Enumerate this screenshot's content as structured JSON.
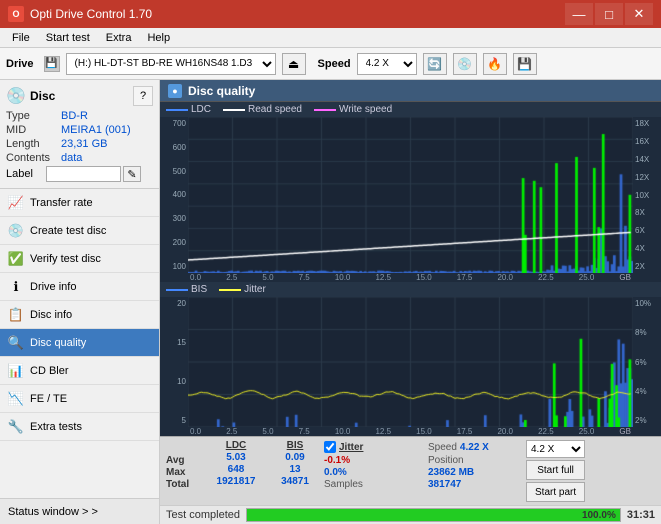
{
  "titleBar": {
    "title": "Opti Drive Control 1.70",
    "minBtn": "—",
    "maxBtn": "□",
    "closeBtn": "✕"
  },
  "menu": {
    "items": [
      "File",
      "Start test",
      "Extra",
      "Help"
    ]
  },
  "toolbar": {
    "driveLabel": "Drive",
    "driveValue": "(H:)  HL-DT-ST BD-RE  WH16NS48 1.D3",
    "speedLabel": "Speed",
    "speedValue": "4.2 X"
  },
  "disc": {
    "title": "Disc",
    "typeLabel": "Type",
    "typeValue": "BD-R",
    "midLabel": "MID",
    "midValue": "MEIRA1 (001)",
    "lengthLabel": "Length",
    "lengthValue": "23,31 GB",
    "contentsLabel": "Contents",
    "contentsValue": "data",
    "labelLabel": "Label"
  },
  "nav": {
    "items": [
      {
        "id": "transfer-rate",
        "label": "Transfer rate",
        "icon": "📈"
      },
      {
        "id": "create-test-disc",
        "label": "Create test disc",
        "icon": "💿"
      },
      {
        "id": "verify-test-disc",
        "label": "Verify test disc",
        "icon": "✅"
      },
      {
        "id": "drive-info",
        "label": "Drive info",
        "icon": "ℹ️"
      },
      {
        "id": "disc-info",
        "label": "Disc info",
        "icon": "📋"
      },
      {
        "id": "disc-quality",
        "label": "Disc quality",
        "icon": "🔍",
        "active": true
      },
      {
        "id": "cd-bler",
        "label": "CD Bler",
        "icon": "📊"
      },
      {
        "id": "fe-te",
        "label": "FE / TE",
        "icon": "📉"
      },
      {
        "id": "extra-tests",
        "label": "Extra tests",
        "icon": "🔧"
      }
    ],
    "statusWindow": "Status window > >"
  },
  "discQuality": {
    "title": "Disc quality",
    "legend1": {
      "ldc": "LDC",
      "readSpeed": "Read speed",
      "writeSpeed": "Write speed"
    },
    "legend2": {
      "bis": "BIS",
      "jitter": "Jitter"
    },
    "topYAxis": [
      "700",
      "600",
      "500",
      "400",
      "300",
      "200",
      "100"
    ],
    "topYAxisRight": [
      "18X",
      "16X",
      "14X",
      "12X",
      "10X",
      "8X",
      "6X",
      "4X",
      "2X"
    ],
    "bottomYAxis": [
      "20",
      "15",
      "10",
      "5"
    ],
    "bottomYAxisRight": [
      "10%",
      "8%",
      "6%",
      "4%",
      "2%"
    ],
    "xAxis": [
      "0.0",
      "2.5",
      "5.0",
      "7.5",
      "10.0",
      "12.5",
      "15.0",
      "17.5",
      "20.0",
      "22.5",
      "25.0"
    ],
    "xAxisLabel": "GB"
  },
  "stats": {
    "headers": [
      "",
      "LDC",
      "BIS",
      "",
      "Jitter",
      "Speed",
      ""
    ],
    "avgRow": {
      "label": "Avg",
      "ldc": "5.03",
      "bis": "0.09",
      "jitter": "-0.1%",
      "speed": "4.22 X"
    },
    "maxRow": {
      "label": "Max",
      "ldc": "648",
      "bis": "13",
      "jitter": "0.0%",
      "position": "23862 MB"
    },
    "totalRow": {
      "label": "Total",
      "ldc": "1921817",
      "bis": "34871",
      "samples": "381747"
    },
    "positionLabel": "Position",
    "samplesLabel": "Samples",
    "speedSelectValue": "4.2 X",
    "jitterChecked": true,
    "startFull": "Start full",
    "startPart": "Start part"
  },
  "statusBar": {
    "text": "Test completed",
    "progress": 100,
    "progressText": "100.0%",
    "time": "31:31"
  },
  "colors": {
    "ldcColor": "#44aaff",
    "bisColor": "#44aaff",
    "readSpeedColor": "#ffffff",
    "writeSpeedColor": "#ff44ff",
    "jitterColor": "#ffff00",
    "greenSpike": "#00ff00",
    "chartBg": "#1e2b3c",
    "gridLine": "#2e3d50"
  }
}
